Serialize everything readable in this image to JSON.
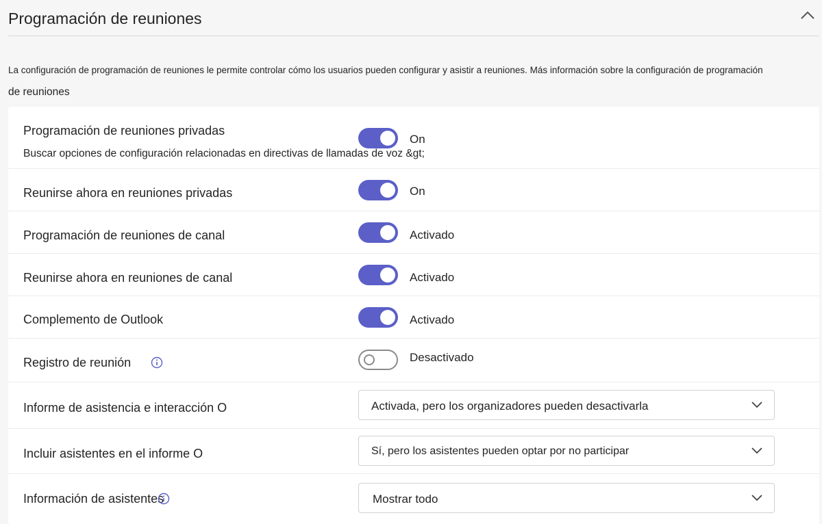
{
  "header": {
    "title": "Programación de reuniones"
  },
  "description": {
    "line1": "La configuración de programación de reuniones le permite controlar cómo los usuarios pueden configurar y asistir a reuniones. Más información sobre la configuración de programación",
    "line2": "de reuniones"
  },
  "settings": {
    "private_scheduling": {
      "label": "Programación de reuniones privadas",
      "sublabel": "Buscar opciones de configuración relacionadas en directivas de llamadas de voz &gt;",
      "state": "On",
      "enabled": true
    },
    "meet_now_private": {
      "label": "Reunirse ahora en reuniones privadas",
      "state": "On",
      "enabled": true
    },
    "channel_scheduling": {
      "label": "Programación de reuniones de canal",
      "state": "Activado",
      "enabled": true
    },
    "meet_now_channel": {
      "label": "Reunirse ahora en reuniones de canal",
      "state": "Activado",
      "enabled": true
    },
    "outlook_addin": {
      "label": "Complemento de Outlook",
      "state": "Activado",
      "enabled": true
    },
    "meeting_registration": {
      "label": "Registro de reunión",
      "state": "Desactivado",
      "enabled": false
    },
    "attendance_report": {
      "label": "Informe de asistencia e interacción O",
      "value": "Activada, pero los organizadores pueden desactivarla"
    },
    "include_attendees": {
      "label": "Incluir asistentes en el informe O",
      "value": "Sí, pero los asistentes pueden optar por no participar"
    },
    "attendee_info": {
      "label": "Información de asistentes",
      "value": "Mostrar todo"
    }
  },
  "colors": {
    "accent": "#5b5fc7",
    "background": "#f6f6f6",
    "panel": "#ffffff"
  },
  "icons": [
    "chevron-up-icon",
    "info-icon",
    "chevron-down-icon"
  ]
}
